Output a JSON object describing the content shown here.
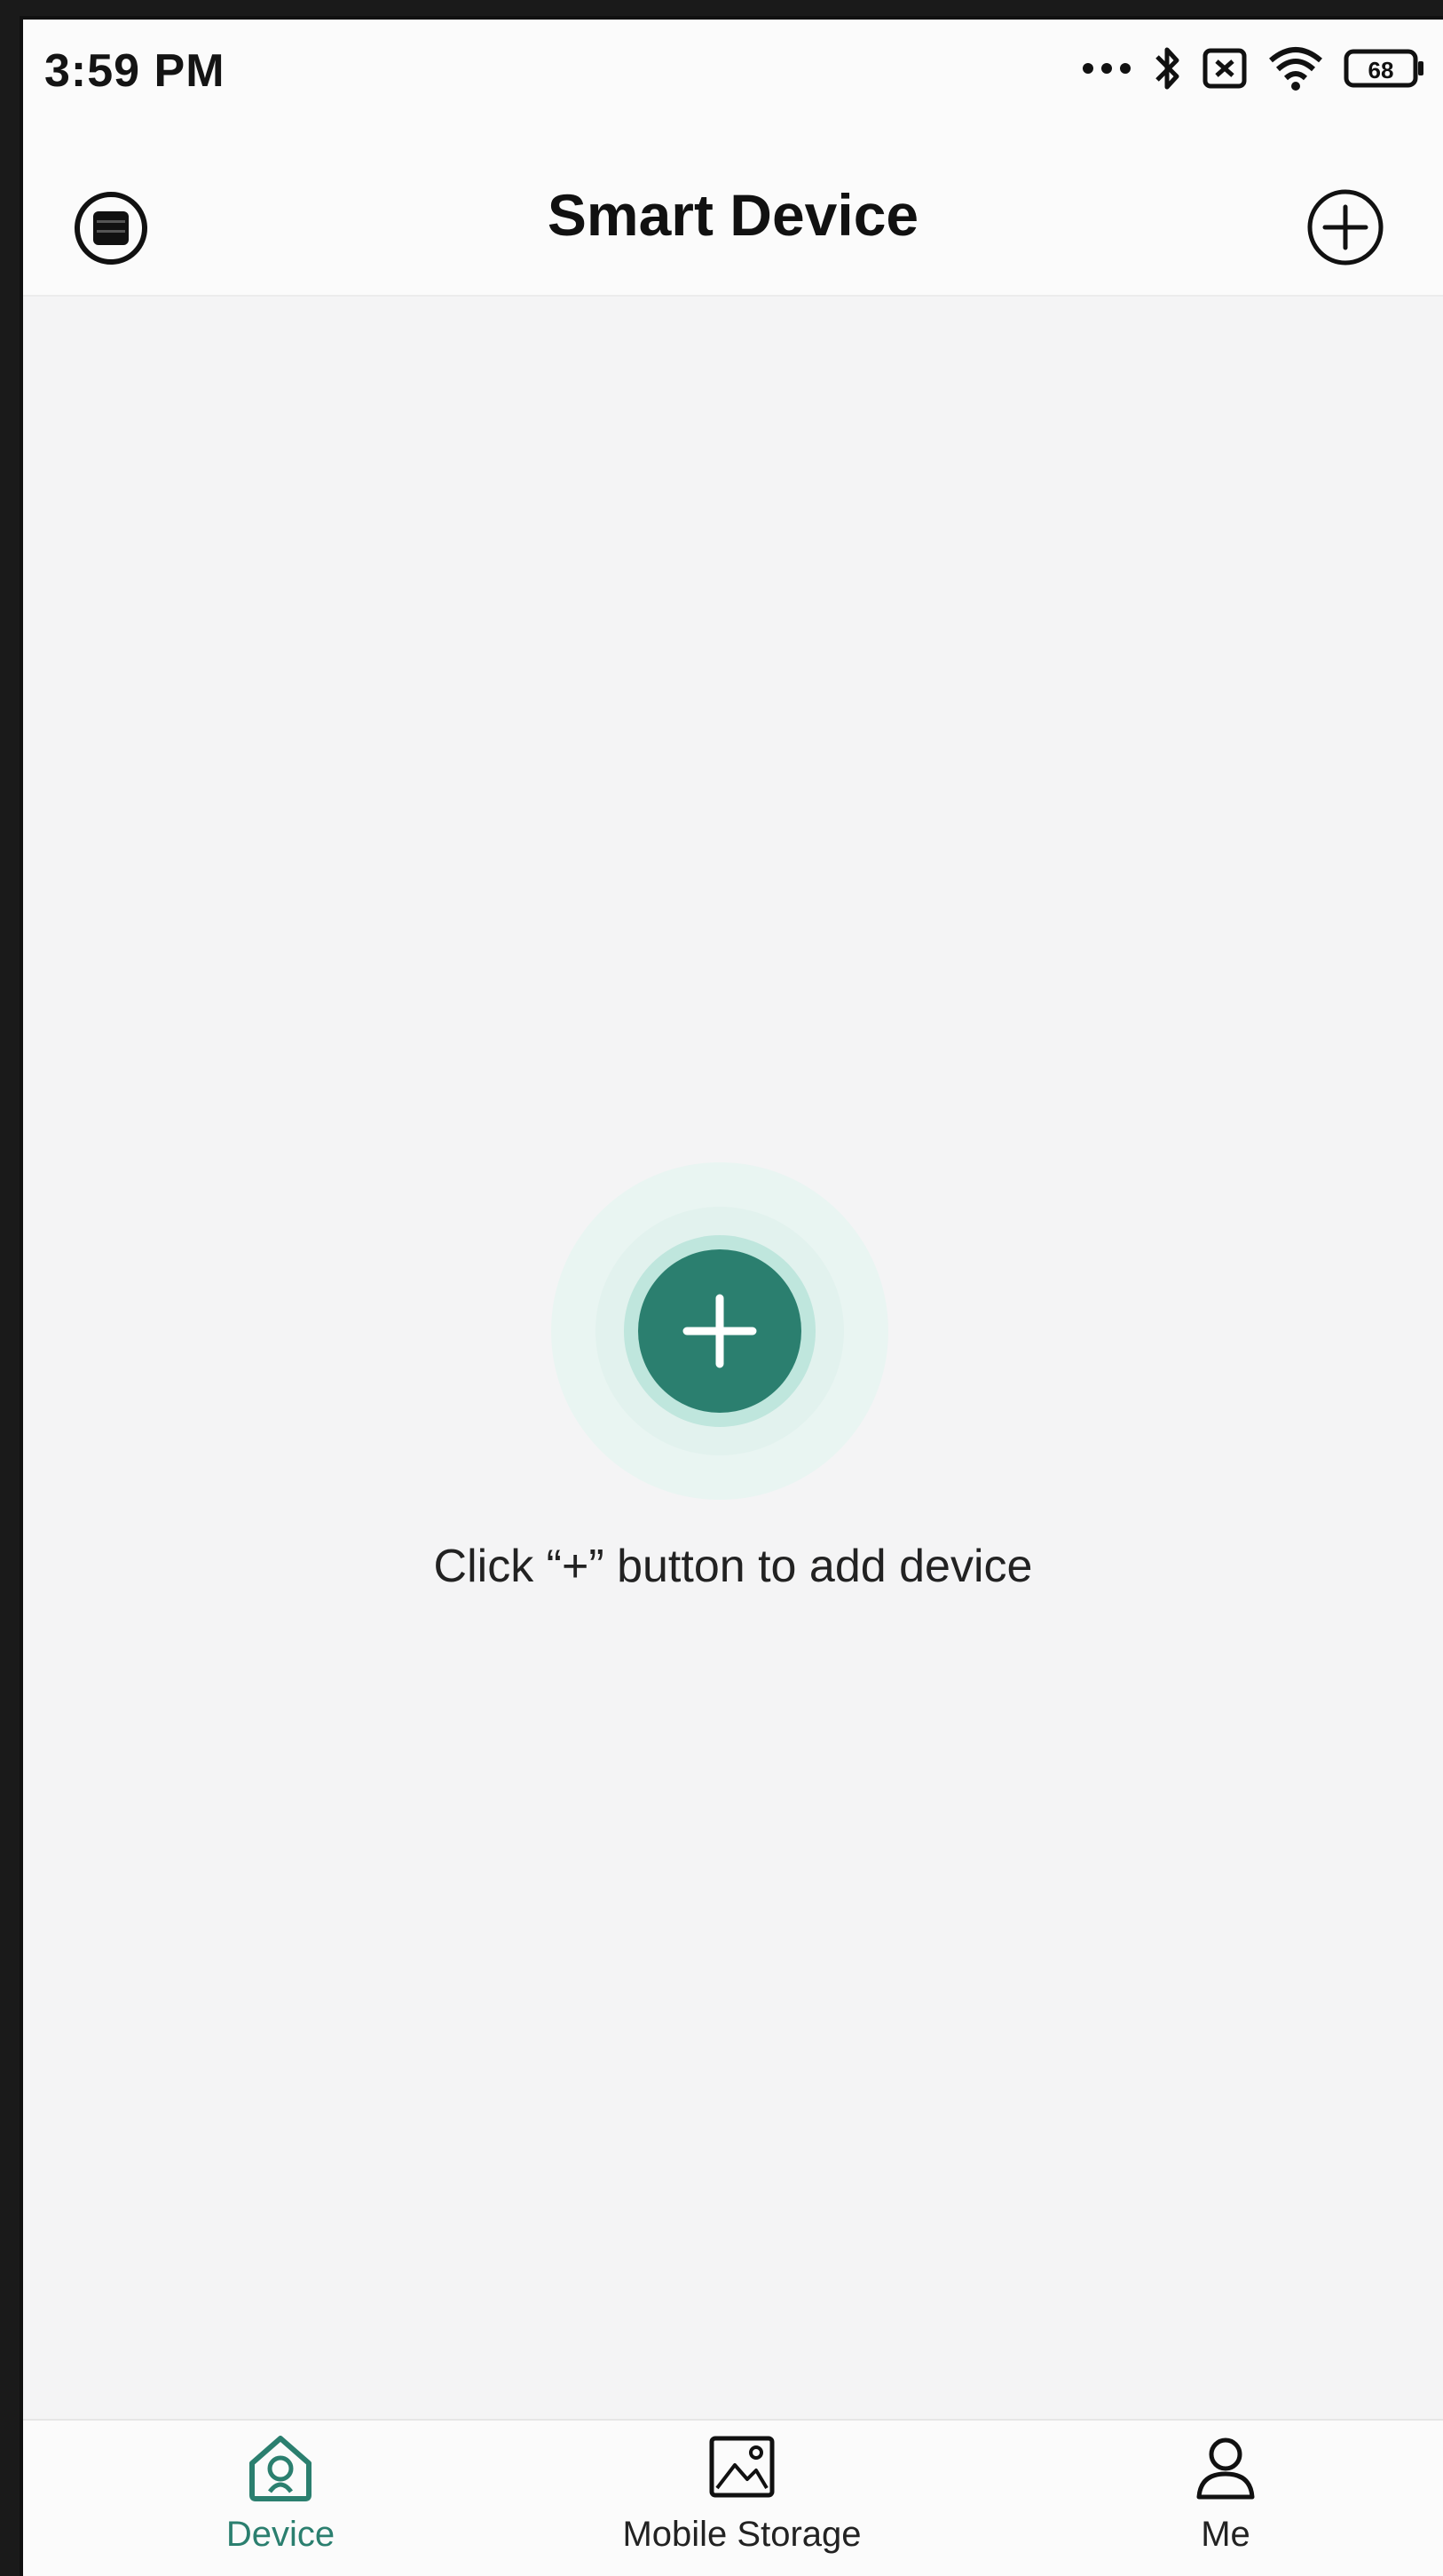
{
  "status_bar": {
    "time": "3:59 PM",
    "battery": "68"
  },
  "header": {
    "title": "Smart Device",
    "menu_icon": "menu-circle-icon",
    "add_icon": "add-circle-icon"
  },
  "empty_state": {
    "add_icon": "add-device-icon",
    "message": "Click “+” button to add device"
  },
  "tabs": [
    {
      "label": "Device",
      "icon": "home-device-icon",
      "active": true
    },
    {
      "label": "Mobile Storage",
      "icon": "image-icon",
      "active": false
    },
    {
      "label": "Me",
      "icon": "user-icon",
      "active": false
    }
  ],
  "colors": {
    "accent": "#2b7f6f",
    "accent_glow": "#d6efe9"
  }
}
